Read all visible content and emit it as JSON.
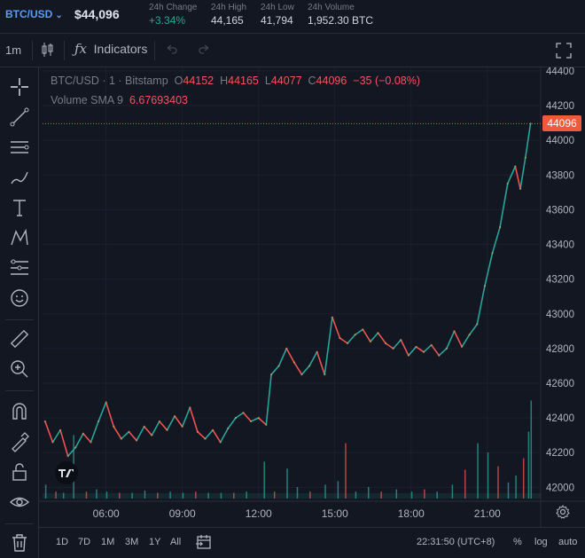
{
  "header": {
    "pair": "BTC/USD",
    "price": "$44,096",
    "stats": [
      {
        "label": "24h Change",
        "value": "+3.34%",
        "up": true
      },
      {
        "label": "24h High",
        "value": "44,165"
      },
      {
        "label": "24h Low",
        "value": "41,794"
      },
      {
        "label": "24h Volume",
        "value": "1,952.30 BTC"
      }
    ]
  },
  "toolbar": {
    "interval": "1m",
    "indicators_label": "Indicators"
  },
  "legend": {
    "symbol": "BTC/USD",
    "interval": "1",
    "exchange": "Bitstamp",
    "o_label": "O",
    "o": "44152",
    "h_label": "H",
    "h": "44165",
    "l_label": "L",
    "l": "44077",
    "c_label": "C",
    "c": "44096",
    "change": "−35 (−0.08%)",
    "volume_label": "Volume SMA 9",
    "volume_value": "6.67693403"
  },
  "price_tag": "44096",
  "bottom": {
    "ranges": [
      "1D",
      "7D",
      "1M",
      "3M",
      "1Y",
      "All"
    ],
    "time": "22:31:50 (UTC+8)",
    "percent": "%",
    "log": "log",
    "auto": "auto"
  },
  "colors": {
    "up": "#26a69a",
    "down": "#ef5350",
    "background": "#131722",
    "last_price": "#f05a3c"
  },
  "chart_data": {
    "type": "line",
    "x_ticks": [
      "06:00",
      "09:00",
      "12:00",
      "15:00",
      "18:00",
      "21:00"
    ],
    "y_ticks": [
      42000,
      42200,
      42400,
      42600,
      42800,
      43000,
      43200,
      43400,
      43600,
      43800,
      44000,
      44200,
      44400
    ],
    "ylim": [
      41920,
      44420
    ],
    "x_range_hours": [
      3.5,
      23.1
    ],
    "last_price": 44096,
    "price_points": [
      [
        3.6,
        42380
      ],
      [
        3.9,
        42260
      ],
      [
        4.2,
        42330
      ],
      [
        4.5,
        42180
      ],
      [
        4.8,
        42230
      ],
      [
        5.1,
        42310
      ],
      [
        5.4,
        42260
      ],
      [
        5.7,
        42380
      ],
      [
        6.0,
        42490
      ],
      [
        6.3,
        42350
      ],
      [
        6.6,
        42280
      ],
      [
        6.9,
        42320
      ],
      [
        7.2,
        42270
      ],
      [
        7.5,
        42350
      ],
      [
        7.8,
        42300
      ],
      [
        8.1,
        42380
      ],
      [
        8.4,
        42330
      ],
      [
        8.7,
        42410
      ],
      [
        9.0,
        42350
      ],
      [
        9.3,
        42460
      ],
      [
        9.6,
        42320
      ],
      [
        9.9,
        42280
      ],
      [
        10.2,
        42330
      ],
      [
        10.5,
        42260
      ],
      [
        10.8,
        42340
      ],
      [
        11.1,
        42400
      ],
      [
        11.4,
        42430
      ],
      [
        11.7,
        42380
      ],
      [
        12.0,
        42400
      ],
      [
        12.3,
        42360
      ],
      [
        12.5,
        42650
      ],
      [
        12.8,
        42700
      ],
      [
        13.1,
        42800
      ],
      [
        13.4,
        42720
      ],
      [
        13.7,
        42650
      ],
      [
        14.0,
        42700
      ],
      [
        14.3,
        42780
      ],
      [
        14.6,
        42650
      ],
      [
        14.9,
        42980
      ],
      [
        15.2,
        42860
      ],
      [
        15.5,
        42830
      ],
      [
        15.8,
        42880
      ],
      [
        16.1,
        42910
      ],
      [
        16.4,
        42840
      ],
      [
        16.7,
        42890
      ],
      [
        17.0,
        42830
      ],
      [
        17.3,
        42800
      ],
      [
        17.6,
        42850
      ],
      [
        17.9,
        42760
      ],
      [
        18.2,
        42810
      ],
      [
        18.5,
        42780
      ],
      [
        18.8,
        42820
      ],
      [
        19.1,
        42760
      ],
      [
        19.4,
        42800
      ],
      [
        19.7,
        42900
      ],
      [
        20.0,
        42810
      ],
      [
        20.3,
        42880
      ],
      [
        20.6,
        42940
      ],
      [
        20.9,
        43160
      ],
      [
        21.2,
        43350
      ],
      [
        21.5,
        43500
      ],
      [
        21.8,
        43750
      ],
      [
        22.1,
        43850
      ],
      [
        22.3,
        43720
      ],
      [
        22.5,
        43900
      ],
      [
        22.7,
        44096
      ]
    ],
    "volume_points": [
      [
        3.6,
        0.12
      ],
      [
        4.0,
        0.06
      ],
      [
        4.3,
        0.05
      ],
      [
        4.7,
        0.55
      ],
      [
        5.2,
        0.06
      ],
      [
        5.6,
        0.08
      ],
      [
        6.0,
        0.06
      ],
      [
        6.5,
        0.05
      ],
      [
        7.0,
        0.05
      ],
      [
        7.5,
        0.07
      ],
      [
        8.0,
        0.05
      ],
      [
        8.5,
        0.06
      ],
      [
        9.0,
        0.05
      ],
      [
        9.5,
        0.06
      ],
      [
        10.0,
        0.05
      ],
      [
        10.5,
        0.05
      ],
      [
        11.0,
        0.05
      ],
      [
        11.5,
        0.06
      ],
      [
        12.2,
        0.32
      ],
      [
        12.6,
        0.06
      ],
      [
        13.1,
        0.26
      ],
      [
        13.5,
        0.1
      ],
      [
        14.0,
        0.06
      ],
      [
        14.6,
        0.12
      ],
      [
        15.1,
        0.15
      ],
      [
        15.4,
        0.48
      ],
      [
        15.8,
        0.06
      ],
      [
        16.3,
        0.1
      ],
      [
        16.8,
        0.06
      ],
      [
        17.4,
        0.08
      ],
      [
        18.0,
        0.06
      ],
      [
        18.5,
        0.08
      ],
      [
        19.0,
        0.06
      ],
      [
        19.6,
        0.12
      ],
      [
        20.1,
        0.25
      ],
      [
        20.6,
        0.48
      ],
      [
        21.0,
        0.4
      ],
      [
        21.4,
        0.28
      ],
      [
        21.8,
        0.14
      ],
      [
        22.1,
        0.2
      ],
      [
        22.4,
        0.35
      ],
      [
        22.6,
        0.58
      ],
      [
        22.7,
        0.85
      ]
    ]
  }
}
